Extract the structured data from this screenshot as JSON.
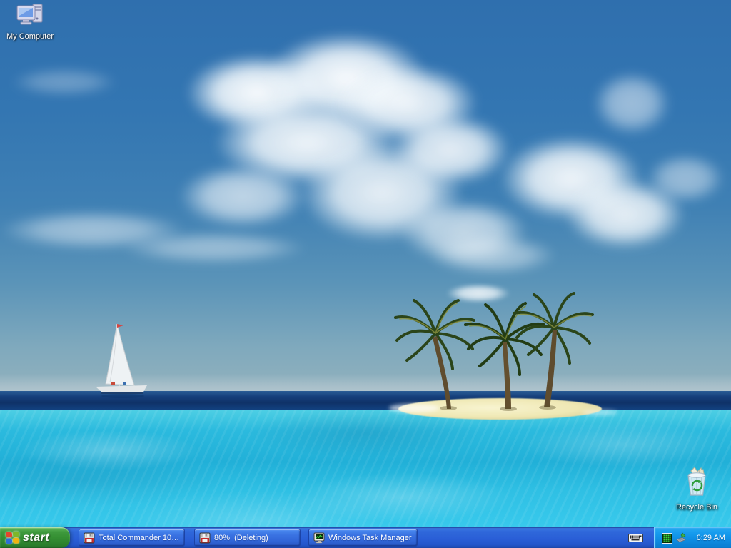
{
  "desktop": {
    "wallpaper": "tropical-island-beach-photo",
    "icons": [
      {
        "id": "my-computer",
        "label": "My Computer"
      },
      {
        "id": "recycle-bin",
        "label": "Recycle Bin"
      }
    ]
  },
  "taskbar": {
    "start_label": "start",
    "buttons": [
      {
        "icon": "total-commander",
        "label": "Total Commander 10...."
      },
      {
        "icon": "total-commander-progress",
        "label": "80%  (Deleting)"
      },
      {
        "icon": "task-manager",
        "label": "Windows Task Manager"
      }
    ],
    "tray": {
      "icons": [
        "keyboard-layout",
        "cpu-usage-meter",
        "safely-remove-hardware"
      ],
      "clock": "6:29 AM"
    }
  },
  "colors": {
    "taskbar_blue": "#2a5fd7",
    "tray_blue": "#129bee",
    "start_green": "#359033",
    "sky_top": "#2f6fae",
    "sea_dark_band": "#0f3268",
    "water_turquoise": "#2fc0e4",
    "sand": "#efe8b4",
    "flag_red": "#e4452c",
    "flag_green": "#7db72a",
    "flag_blue": "#2c6fd4",
    "flag_yellow": "#efb410"
  }
}
